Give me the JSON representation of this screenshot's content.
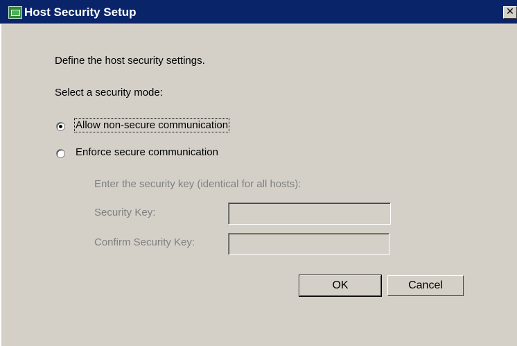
{
  "window": {
    "title": "Host Security Setup",
    "close_glyph": "✕",
    "app_icon": "host-app-icon"
  },
  "dialog": {
    "description": "Define the host security settings.",
    "mode_prompt": "Select a security mode:",
    "options": [
      {
        "label": "Allow non-secure communication",
        "selected": true
      },
      {
        "label": "Enforce secure communication",
        "selected": false
      }
    ],
    "key_prompt": "Enter the security key (identical for all hosts):",
    "security_key_label": "Security Key:",
    "security_key_value": "",
    "confirm_key_label": "Confirm Security Key:",
    "confirm_key_value": ""
  },
  "buttons": {
    "ok": "OK",
    "cancel": "Cancel"
  }
}
